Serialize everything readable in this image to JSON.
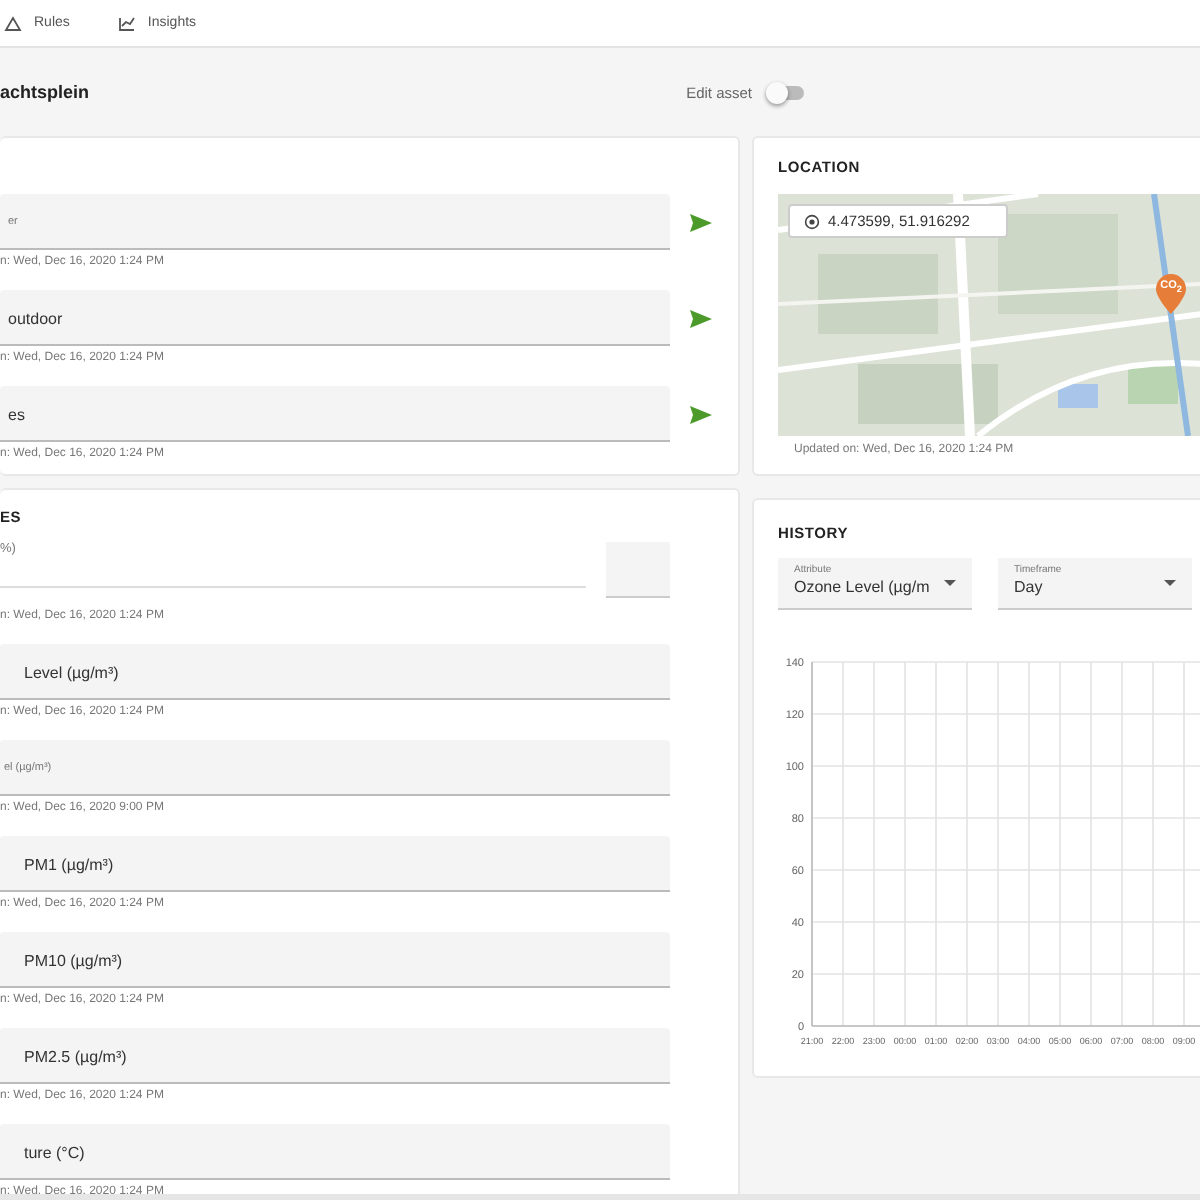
{
  "nav": [
    {
      "label": "Rules"
    },
    {
      "label": "Insights"
    }
  ],
  "asset": {
    "title": "achtsplein",
    "edit": {
      "label": "Edit asset",
      "on": false
    }
  },
  "info_fields": [
    {
      "label": "er",
      "helper": "n: Wed, Dec 16, 2020 1:24 PM"
    },
    {
      "value": "outdoor",
      "helper": "n: Wed, Dec 16, 2020 1:24 PM"
    },
    {
      "value": "es",
      "helper": "n: Wed, Dec 16, 2020 1:24 PM"
    }
  ],
  "location": {
    "title": "LOCATION",
    "coordinates": "4.473599, 51.916292",
    "marker": "CO$_{2}$",
    "updated": "Updated on: Wed, Dec 16, 2020 1:24 PM"
  },
  "attributes": {
    "title": "ES",
    "fields": [
      {
        "kind": "line",
        "label": "%)",
        "helper": "n: Wed, Dec 16, 2020 1:24 PM"
      },
      {
        "kind": "filled",
        "value": "Level (µg/m³)",
        "helper": "n: Wed, Dec 16, 2020 1:24 PM"
      },
      {
        "kind": "filled",
        "label": "el (µg/m³)",
        "helper": "n: Wed, Dec 16, 2020 9:00 PM"
      },
      {
        "kind": "filled",
        "value": "PM1 (µg/m³)",
        "helper": "n: Wed, Dec 16, 2020 1:24 PM"
      },
      {
        "kind": "filled",
        "value": "PM10 (µg/m³)",
        "helper": "n: Wed, Dec 16, 2020 1:24 PM"
      },
      {
        "kind": "filled",
        "value": "PM2.5 (µg/m³)",
        "helper": "n: Wed, Dec 16, 2020 1:24 PM"
      },
      {
        "kind": "filled",
        "value": "ture (°C)",
        "helper": "n: Wed, Dec 16, 2020 1:24 PM"
      }
    ]
  },
  "history": {
    "title": "HISTORY",
    "selects": [
      {
        "label": "Attribute",
        "value": "Ozone Level (µg/m"
      },
      {
        "label": "Timeframe",
        "value": "Day"
      }
    ],
    "chart_data": {
      "type": "line",
      "categories": [
        "21:00",
        "22:00",
        "23:00",
        "00:00",
        "01:00",
        "02:00",
        "03:00",
        "04:00",
        "05:00",
        "06:00",
        "07:00",
        "08:00",
        "09:00"
      ],
      "ylim": [
        0,
        140
      ],
      "grid": true,
      "yticks": [
        0,
        20,
        40,
        60,
        80,
        100,
        120,
        140
      ]
    }
  }
}
